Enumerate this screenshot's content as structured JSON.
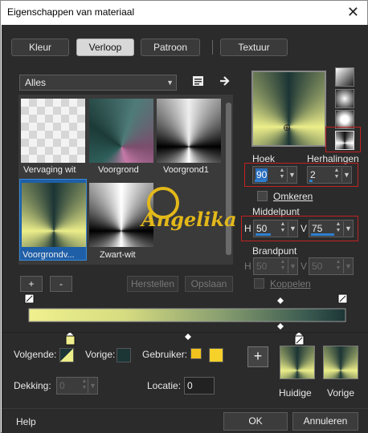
{
  "window": {
    "title": "Eigenschappen van materiaal",
    "close": "✕"
  },
  "tabs": [
    {
      "label": "Kleur"
    },
    {
      "label": "Verloop"
    },
    {
      "label": "Patroon"
    },
    {
      "label": "Textuur"
    }
  ],
  "gallery": {
    "category": "Alles",
    "items": [
      {
        "label": "Vervaging wit"
      },
      {
        "label": "Voorgrond"
      },
      {
        "label": "Voorgrond1"
      },
      {
        "label": "Voorgrondv..."
      },
      {
        "label": "Zwart-wit"
      }
    ],
    "selected_index": 3
  },
  "buttons": {
    "add": "+",
    "remove": "-",
    "reset": "Herstellen",
    "save": "Opslaan",
    "help": "Help",
    "ok": "OK",
    "cancel": "Annuleren",
    "add_color": "+"
  },
  "properties": {
    "angle_label": "Hoek",
    "angle_value": "90",
    "repeats_label": "Herhalingen",
    "repeats_value": "2",
    "invert_label": "Omkeren",
    "center_label": "Middelpunt",
    "h_label": "H",
    "h_value": "50",
    "v_label": "V",
    "v_value": "75",
    "focal_label": "Brandpunt",
    "fh_label": "H",
    "fh_value": "50",
    "fv_label": "V",
    "fv_value": "50",
    "link_label": "Koppelen"
  },
  "watermark": "Angelika",
  "bottom": {
    "next_label": "Volgende:",
    "prev_label": "Vorige:",
    "user_label": "Gebruiker:",
    "opacity_label": "Dekking:",
    "opacity_value": "0",
    "location_label": "Locatie:",
    "location_value": "0",
    "current_label": "Huidige",
    "previous_label": "Vorige"
  },
  "colors": {
    "yellow": "#ecee8a",
    "dark": "#1c3535",
    "user_a": "#f2c21e",
    "user_b": "#f5d12a",
    "red_highlight": "#c22222",
    "accent": "#2d7fd0"
  }
}
